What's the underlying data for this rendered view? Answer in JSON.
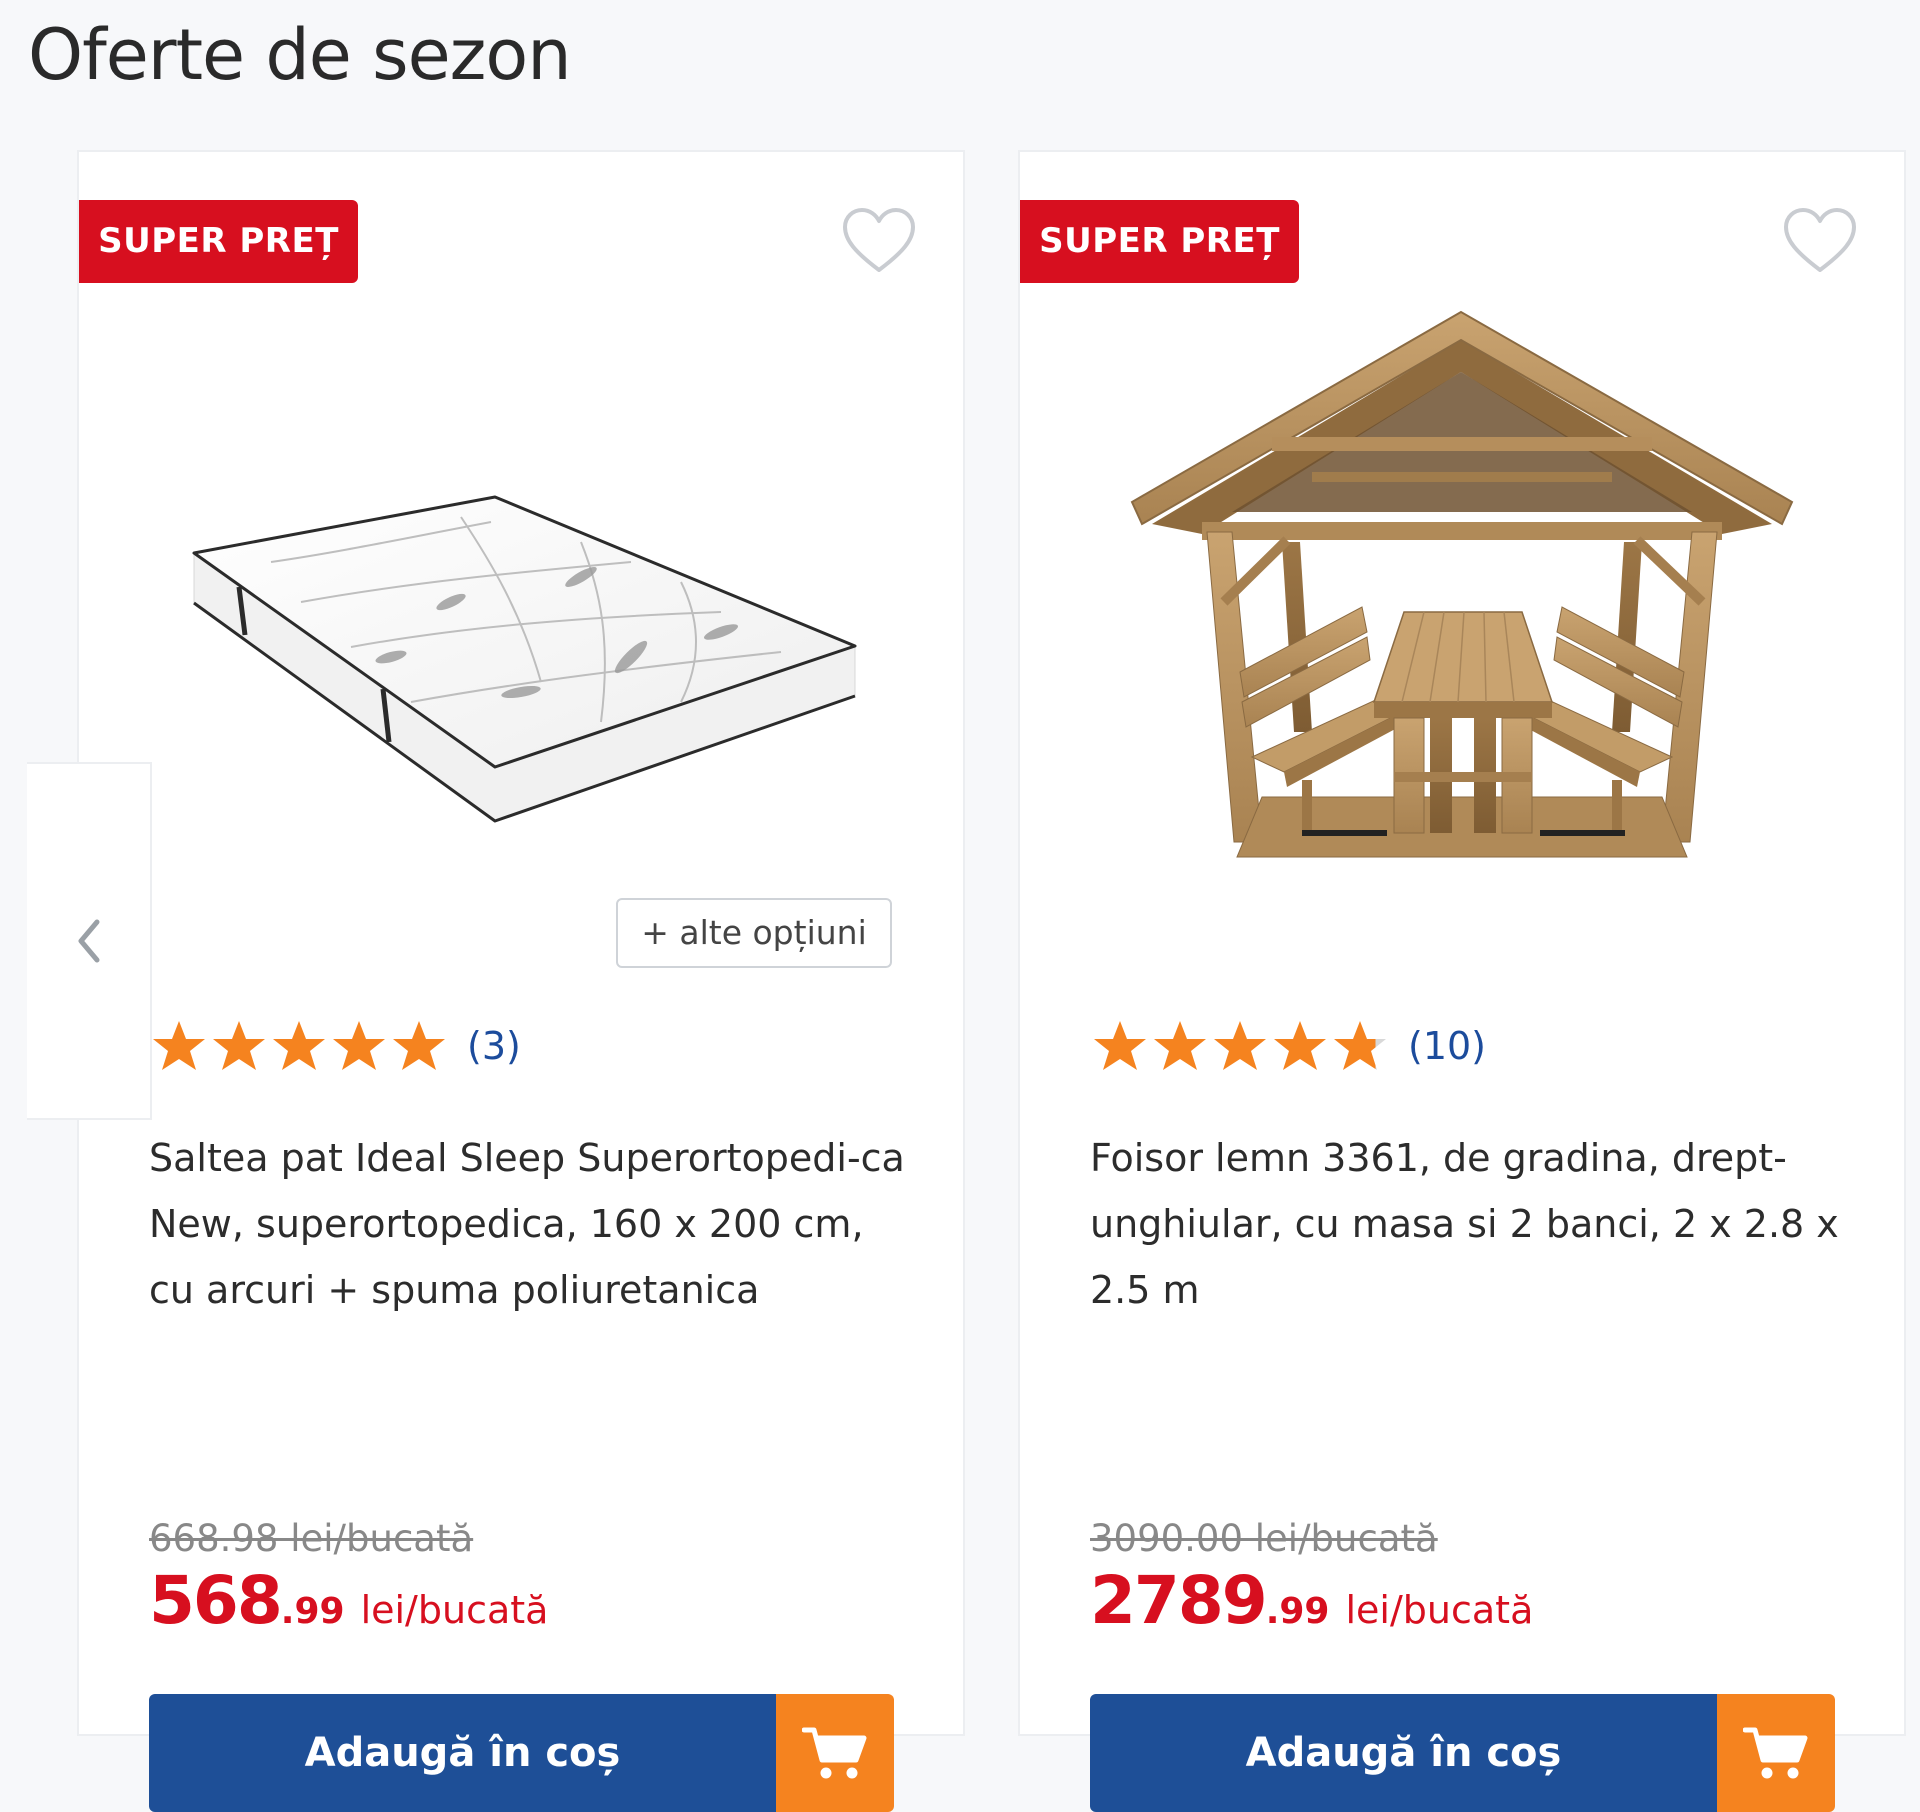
{
  "section": {
    "title": "Oferte de sezon"
  },
  "colors": {
    "badge": "#d70f1f",
    "price": "#d70f1f",
    "button": "#1e4f97",
    "cart": "#f5831f",
    "star": "#f5831f",
    "link": "#1c4c9c"
  },
  "carousel": {
    "prev_icon": "chevron-left-icon"
  },
  "products": [
    {
      "badge": "SUPER PREȚ",
      "favorite_icon": "heart-outline-icon",
      "image": "mattress",
      "options_label": "+ alte opțiuni",
      "rating": 5,
      "review_count": "(3)",
      "title": "Saltea pat Ideal Sleep Superortopedi-ca New, superortopedica, 160 x 200 cm, cu arcuri + spuma poliuretanica",
      "old_price": "668.98 lei/bucată",
      "price_int": "568",
      "price_dec": ".99",
      "price_unit": "lei/bucată",
      "add_to_cart": "Adaugă în coș",
      "cart_icon": "shopping-cart-icon"
    },
    {
      "badge": "SUPER PREȚ",
      "favorite_icon": "heart-outline-icon",
      "image": "wooden-gazebo",
      "rating": 4.8,
      "review_count": "(10)",
      "title": "Foisor lemn 3361, de gradina, drept-unghiular, cu masa si 2 banci, 2 x 2.8 x 2.5 m",
      "old_price": "3090.00 lei/bucată",
      "price_int": "2789",
      "price_dec": ".99",
      "price_unit": "lei/bucată",
      "add_to_cart": "Adaugă în coș",
      "cart_icon": "shopping-cart-icon"
    }
  ]
}
